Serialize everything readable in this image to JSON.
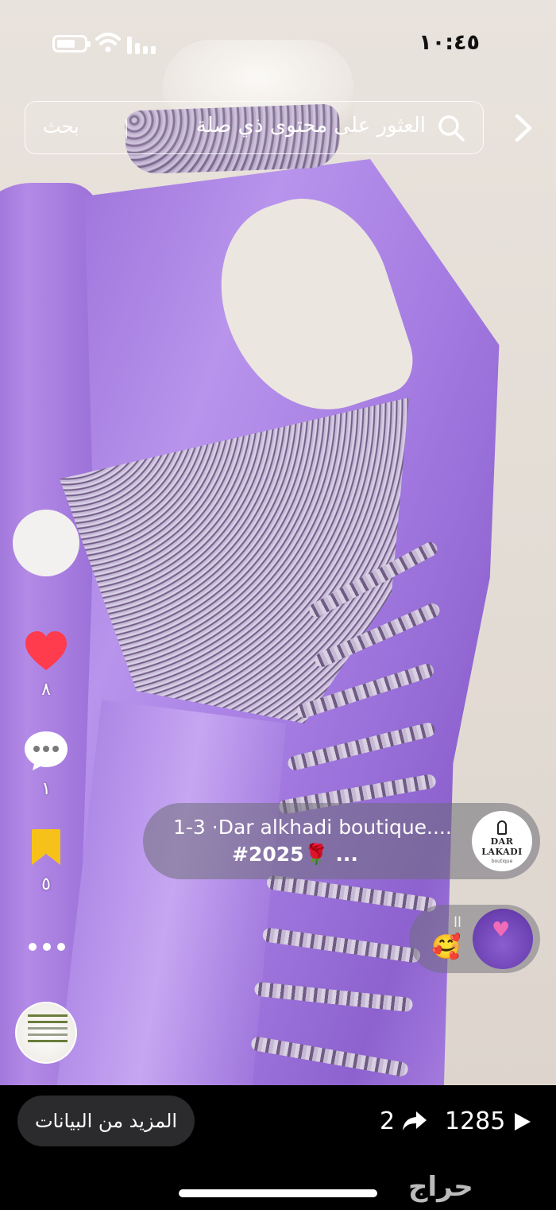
{
  "status_bar": {
    "time": "١٠:٤٥",
    "icons": [
      "battery-icon",
      "wifi-icon",
      "signal-icon"
    ]
  },
  "search": {
    "placeholder": "العثور على محتوى ذي صلة",
    "button_label": "بحث"
  },
  "actions": {
    "likes": "٨",
    "comments": "١",
    "saves": "٥"
  },
  "caption": {
    "line1": "1-3 ·Dar alkhadi  boutique....",
    "line2": "#2025🌹 ...",
    "logo_text": "DAR LAKADI",
    "logo_sub": "boutique"
  },
  "comment": {
    "user": "اا",
    "text": "🥰"
  },
  "bottom": {
    "more_info": "المزيد من البيانات",
    "views": "1285",
    "shares": "2"
  },
  "watermark": "حراج",
  "colors": {
    "like_red": "#ff3b4e",
    "save_yellow": "#f6c21a",
    "dress_purple": "#a57ce2"
  }
}
